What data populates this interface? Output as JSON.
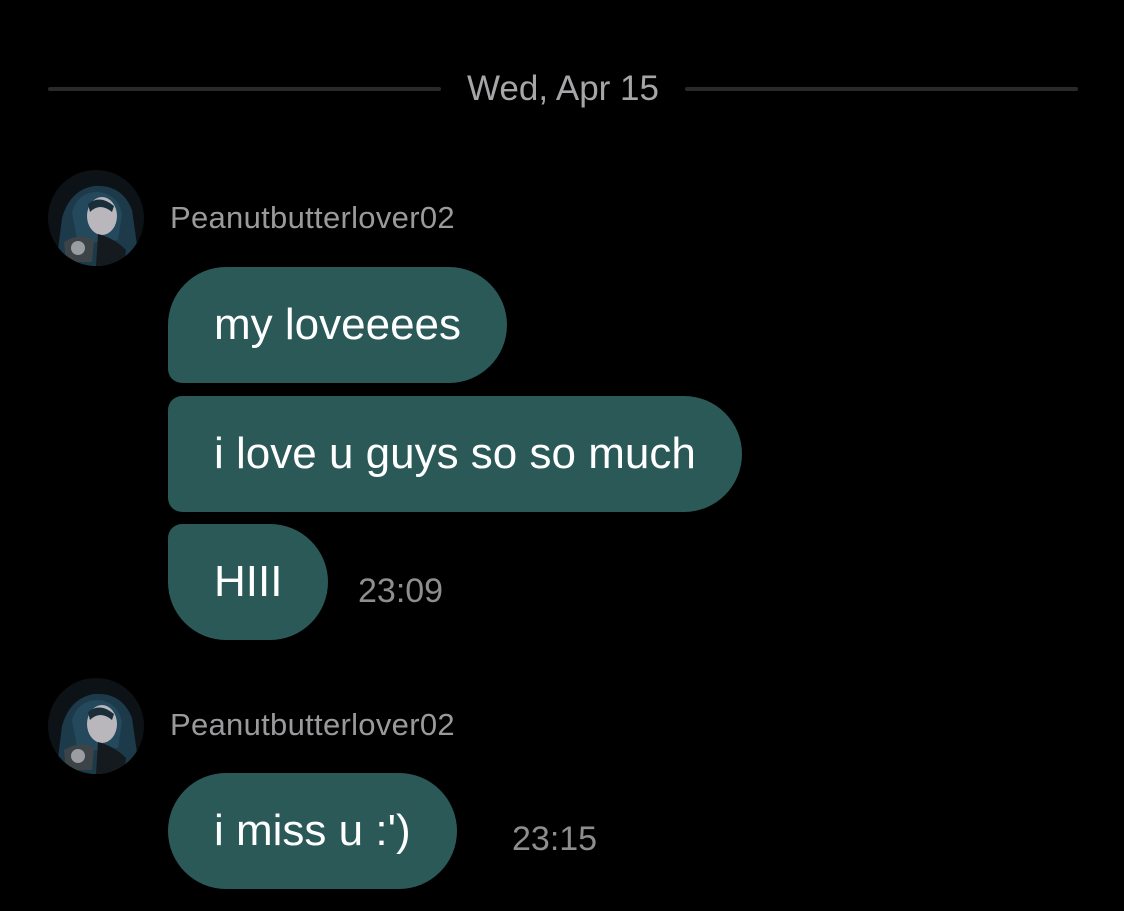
{
  "date_divider": "Wed, Apr 15",
  "groups": [
    {
      "sender": "Peanutbutterlover02",
      "messages": [
        {
          "text": "my loveeees"
        },
        {
          "text": "i love u guys so so much"
        },
        {
          "text": "HIII",
          "time": "23:09"
        }
      ]
    },
    {
      "sender": "Peanutbutterlover02",
      "messages": [
        {
          "text": "i miss u :')",
          "time": "23:15"
        }
      ]
    }
  ],
  "colors": {
    "background": "#000000",
    "bubble": "#2a5958",
    "bubble_text": "#ffffff",
    "meta_text": "#9a9a9c"
  }
}
